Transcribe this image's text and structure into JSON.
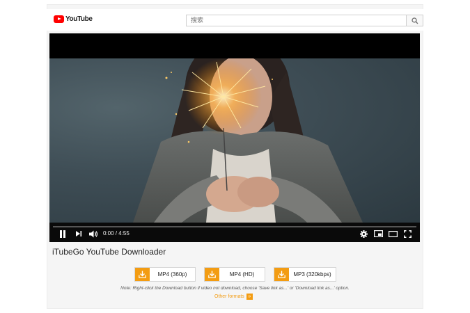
{
  "header": {
    "logo_text": "YouTube",
    "search_placeholder": "搜索",
    "icons": {
      "logo": "youtube-play-logo",
      "search": "search-icon"
    }
  },
  "player": {
    "time_display": "0:00 / 4:55",
    "progress": 0,
    "icons": [
      "pause-icon",
      "next-icon",
      "volume-icon",
      "settings-icon",
      "miniplayer-icon",
      "theater-mode-icon",
      "fullscreen-icon"
    ]
  },
  "downloader": {
    "title": "iTubeGo YouTube Downloader",
    "buttons": [
      {
        "label": "MP4 (360p)",
        "icon": "download-icon"
      },
      {
        "label": "MP4 (HD)",
        "icon": "download-icon"
      },
      {
        "label": "MP3 (320kbps)",
        "icon": "download-icon"
      }
    ],
    "note": "Note: Right-click the Download button if video not download, choose 'Save link as...' or 'Download link as...' option.",
    "other_formats": "Other formats"
  },
  "colors": {
    "accent": "#f39c12",
    "youtube_red": "#ff0000",
    "player_bg": "#000000"
  }
}
